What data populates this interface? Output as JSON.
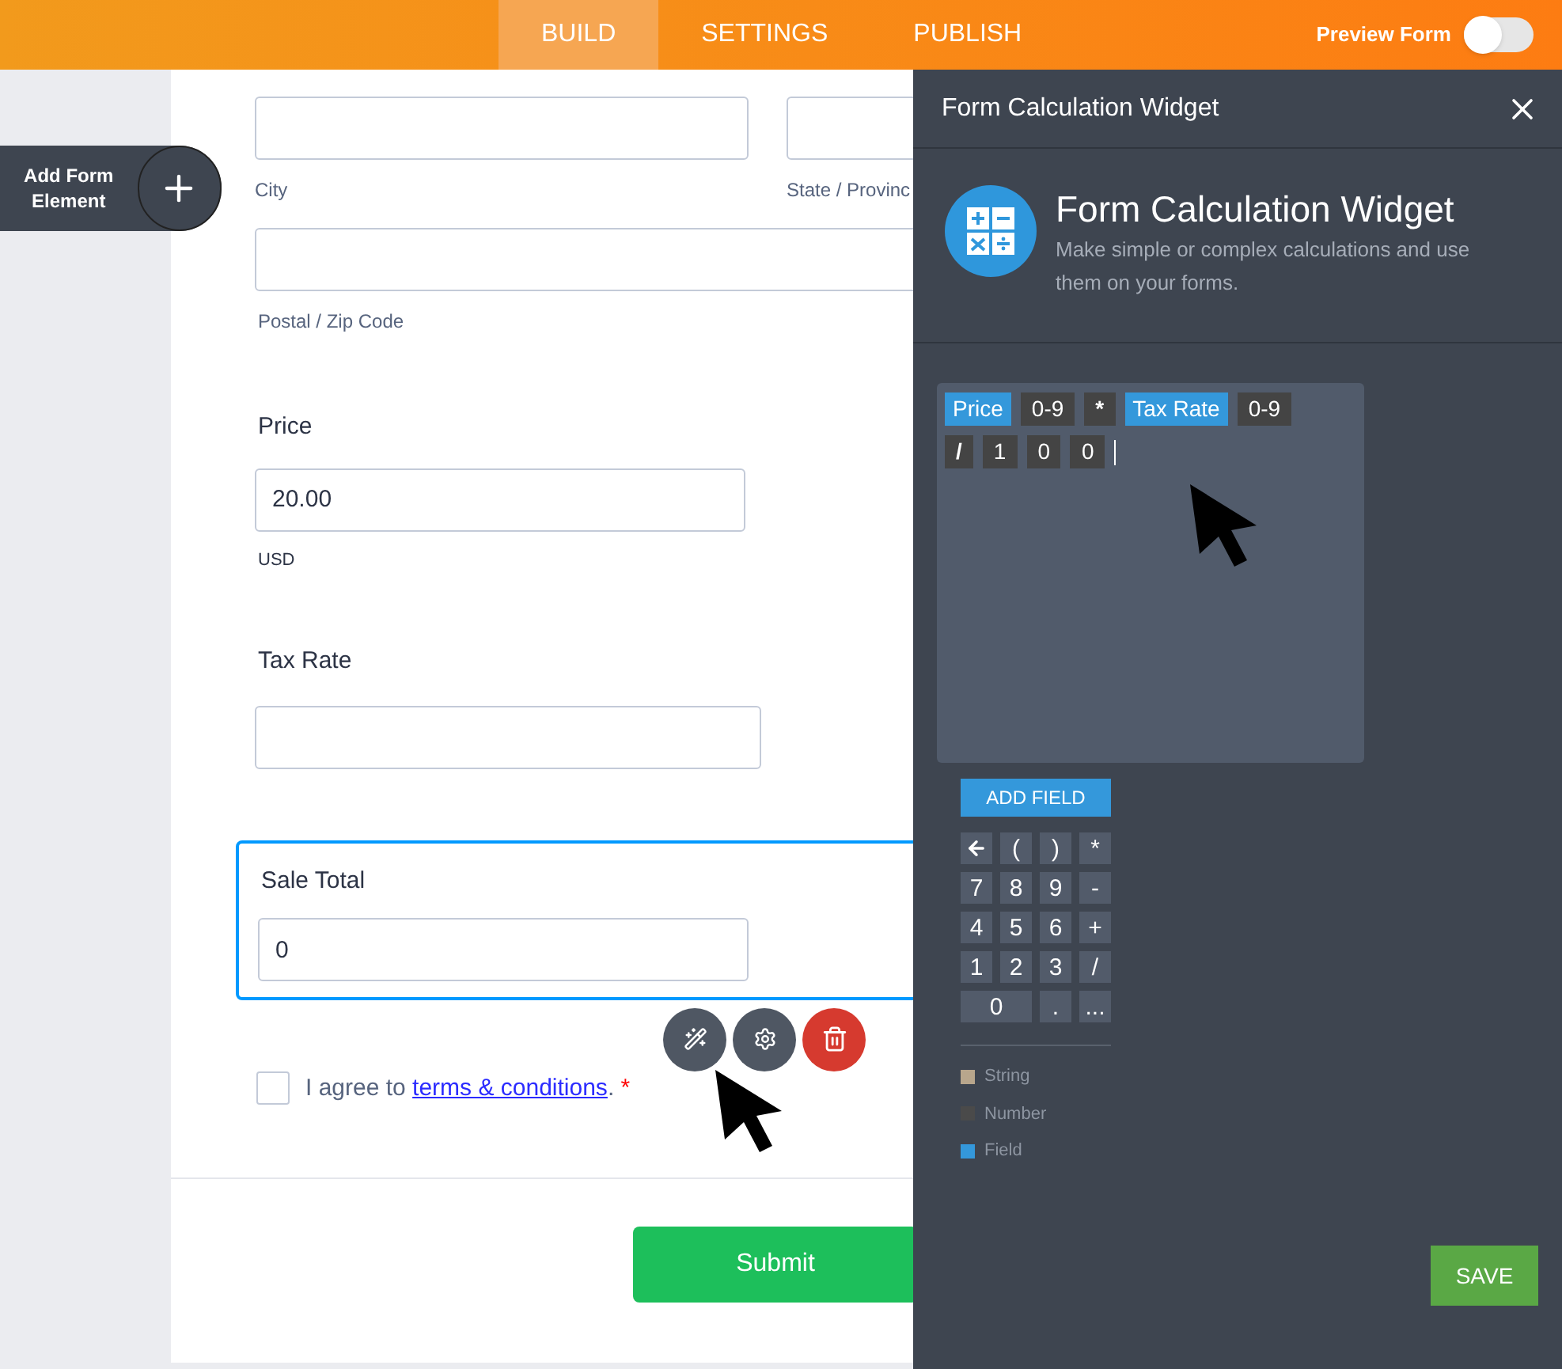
{
  "top_nav": {
    "tabs": [
      {
        "label": "BUILD",
        "selected": true
      },
      {
        "label": "SETTINGS",
        "selected": false
      },
      {
        "label": "PUBLISH",
        "selected": false
      }
    ],
    "preview": {
      "label": "Preview Form",
      "on": false
    }
  },
  "add_element": {
    "label": "Add Form Element"
  },
  "form": {
    "address": [
      {
        "label": "City"
      },
      {
        "label": "State / Provinc"
      },
      {
        "label": "Postal / Zip Code"
      }
    ],
    "price": {
      "label": "Price",
      "value": "20.00",
      "sublabel": "USD"
    },
    "tax_rate": {
      "label": "Tax Rate"
    },
    "sale_total": {
      "label": "Sale Total",
      "value": "0",
      "selected": true
    },
    "agree": {
      "before": "I agree to ",
      "link": "terms & conditions",
      "after": ".",
      "required": "*",
      "checked": false
    },
    "submit": "Submit"
  },
  "panel": {
    "title": "Form Calculation Widget",
    "widget_title": "Form Calculation Widget",
    "widget_description": "Make simple or complex calculations and use them on your forms.",
    "formula": [
      [
        {
          "text": "Price",
          "kind": "field"
        },
        {
          "text": "0-9",
          "kind": "number"
        },
        {
          "text": "*",
          "kind": "operator"
        },
        {
          "text": "Tax Rate",
          "kind": "field"
        },
        {
          "text": "0-9",
          "kind": "number"
        }
      ],
      [
        {
          "text": "/",
          "kind": "operator"
        },
        {
          "text": "1",
          "kind": "number"
        },
        {
          "text": "0",
          "kind": "number"
        },
        {
          "text": "0",
          "kind": "number"
        }
      ]
    ],
    "add_field": "ADD FIELD",
    "keys": [
      {
        "kind": "backspace"
      },
      {
        "kind": "key",
        "label": "("
      },
      {
        "kind": "key",
        "label": ")"
      },
      {
        "kind": "key",
        "label": "*"
      },
      {
        "kind": "key",
        "label": "7"
      },
      {
        "kind": "key",
        "label": "8"
      },
      {
        "kind": "key",
        "label": "9"
      },
      {
        "kind": "key",
        "label": "-"
      },
      {
        "kind": "key",
        "label": "4"
      },
      {
        "kind": "key",
        "label": "5"
      },
      {
        "kind": "key",
        "label": "6"
      },
      {
        "kind": "key",
        "label": "+"
      },
      {
        "kind": "key",
        "label": "1"
      },
      {
        "kind": "key",
        "label": "2"
      },
      {
        "kind": "key",
        "label": "3"
      },
      {
        "kind": "key",
        "label": "/"
      },
      {
        "kind": "wide",
        "label": "0"
      },
      {
        "kind": "key",
        "label": "."
      },
      {
        "kind": "key",
        "label": "..."
      }
    ],
    "legend": [
      {
        "label": "String",
        "color": "#b8a68c"
      },
      {
        "label": "Number",
        "color": "#4a4a4a"
      },
      {
        "label": "Field",
        "color": "#3498db"
      }
    ],
    "save": "SAVE"
  }
}
